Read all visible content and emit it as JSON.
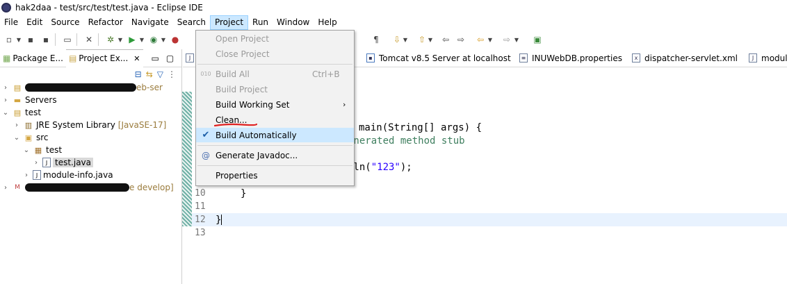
{
  "window": {
    "title": "hak2daa - test/src/test/test.java - Eclipse IDE"
  },
  "menubar": [
    "File",
    "Edit",
    "Source",
    "Refactor",
    "Navigate",
    "Search",
    "Project",
    "Run",
    "Window",
    "Help"
  ],
  "project_menu": {
    "open_project": "Open Project",
    "close_project": "Close Project",
    "build_all": "Build All",
    "build_all_shortcut": "Ctrl+B",
    "build_project": "Build Project",
    "build_working_set": "Build Working Set",
    "clean": "Clean...",
    "build_automatically": "Build Automatically",
    "generate_javadoc": "Generate Javadoc...",
    "properties": "Properties"
  },
  "left_tabs": {
    "package_explorer": "Package E...",
    "project_explorer": "Project Ex..."
  },
  "tree": {
    "row1_suffix": "eb-ser",
    "servers": "Servers",
    "test": "test",
    "jre": "JRE System Library",
    "jre_dec": "[JavaSE-17]",
    "src": "src",
    "pkg_test": "test",
    "test_java": "test.java",
    "module_info": "module-info.java",
    "row_last_suffix": "e develop]"
  },
  "editor_tabs": [
    "Tomcat v8.5 Server at localhost",
    "INUWebDB.properties",
    "dispatcher-servlet.xml",
    "module"
  ],
  "code": {
    "line_main": "main(String[] args) {",
    "line_comment": "enerated method stub",
    "line_println_pre": "tln(",
    "line_println_str": "\"123\"",
    "line_println_post": ");",
    "line_close_inner": "}",
    "line_close_outer": "}",
    "ln10": "10",
    "ln11": "11",
    "ln12": "12",
    "ln13": "13"
  },
  "colors": {
    "annotation_red": "#e02020",
    "menu_highlight": "#cce8ff"
  }
}
